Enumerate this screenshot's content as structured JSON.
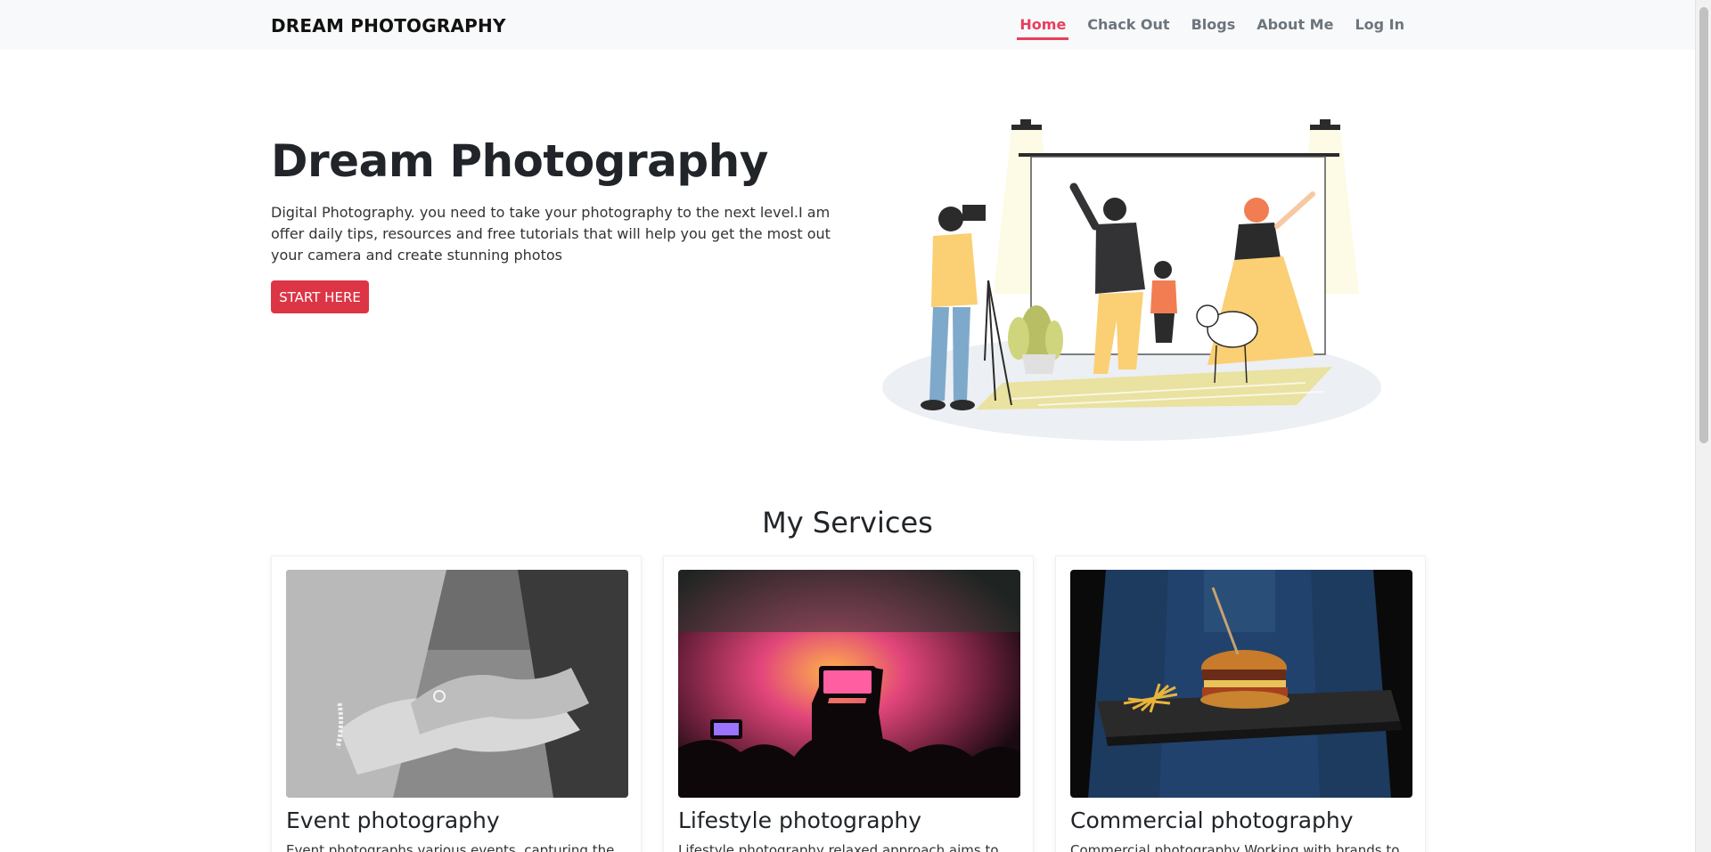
{
  "navbar": {
    "brand": "DREAM PHOTOGRAPHY",
    "links": [
      {
        "label": "Home",
        "active": true
      },
      {
        "label": "Chack Out"
      },
      {
        "label": "Blogs"
      },
      {
        "label": "About Me"
      },
      {
        "label": "Log In"
      }
    ]
  },
  "hero": {
    "title": "Dream Photography",
    "description": "Digital Photography. you need to take your photography to the next level.I am offer daily tips, resources and free tutorials that will help you get the most out your camera and create stunning photos",
    "button_label": "START HERE"
  },
  "services": {
    "title": "My Services",
    "cards": [
      {
        "title": "Event photography",
        "text": "Event photographs various events, capturing the"
      },
      {
        "title": "Lifestyle photography",
        "text": "Lifestyle photography relaxed approach aims to make"
      },
      {
        "title": "Commercial photography",
        "text": "Commercial photography Working with brands to"
      }
    ]
  },
  "colors": {
    "accent": "#e83e5c",
    "button": "#dc3545",
    "navbar_bg": "#f8f9fa"
  }
}
